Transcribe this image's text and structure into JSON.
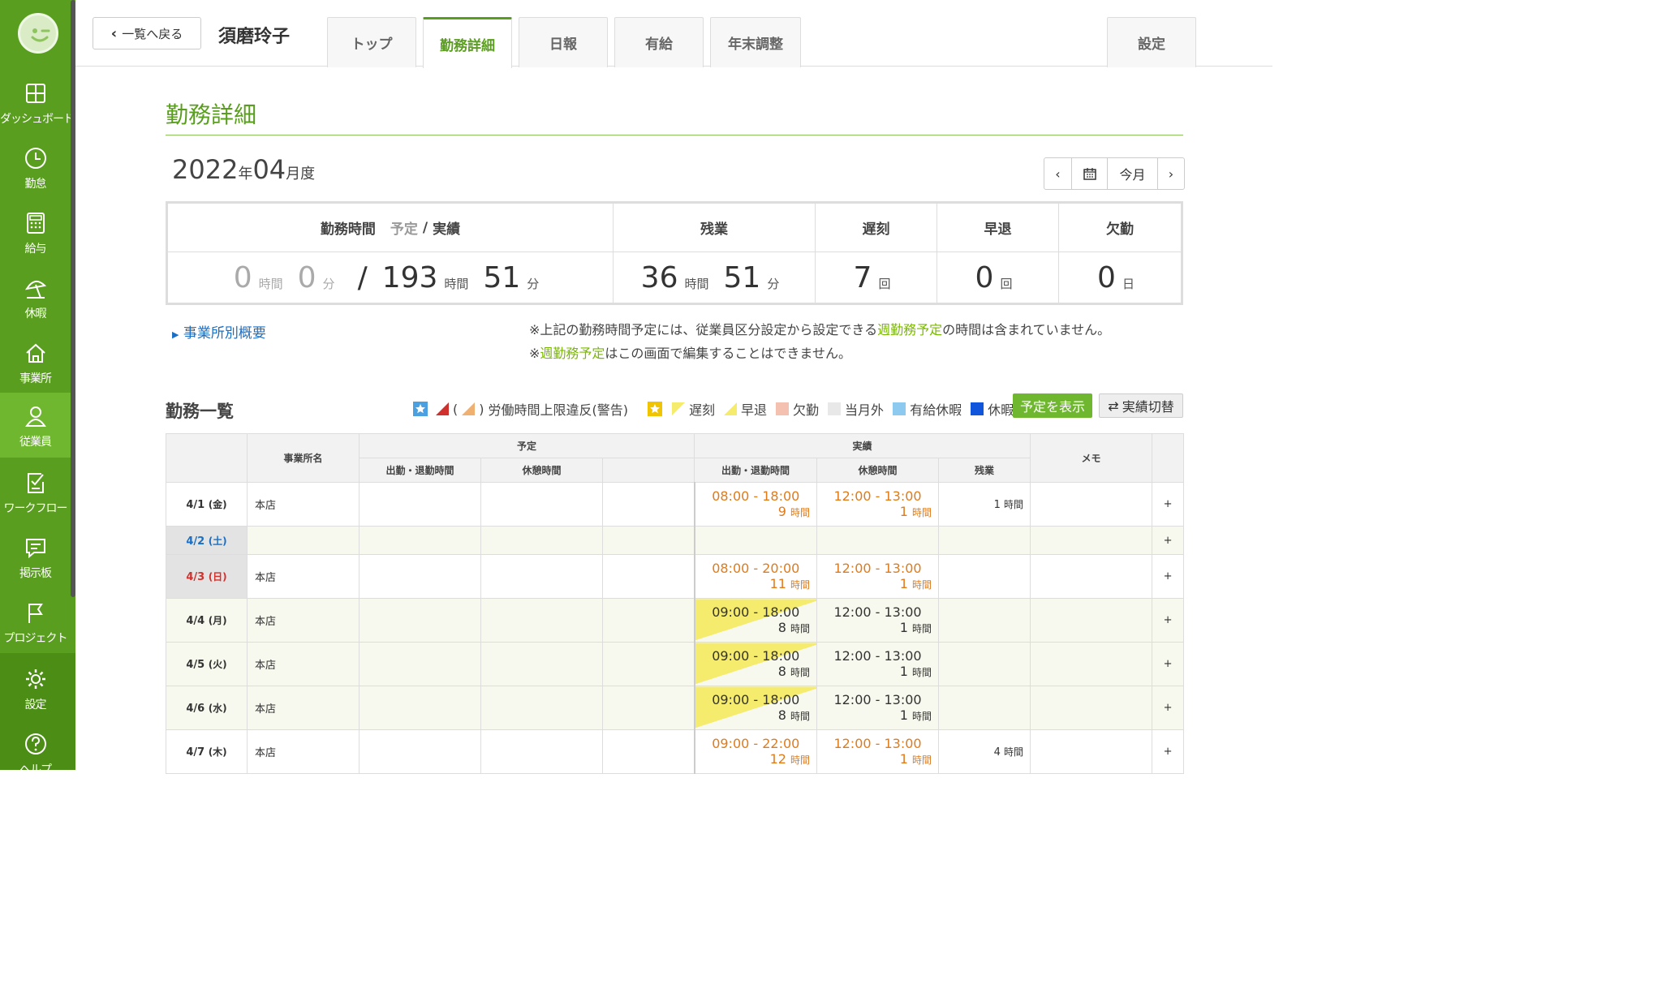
{
  "sidebar": {
    "items": [
      {
        "label": "ダッシュボード",
        "icon": "dashboard-icon"
      },
      {
        "label": "勤怠",
        "icon": "clock-icon"
      },
      {
        "label": "給与",
        "icon": "calculator-icon"
      },
      {
        "label": "休暇",
        "icon": "beach-umbrella-icon"
      },
      {
        "label": "事業所",
        "icon": "home-icon"
      },
      {
        "label": "従業員",
        "icon": "person-icon"
      },
      {
        "label": "ワークフロー",
        "icon": "checklist-icon"
      },
      {
        "label": "掲示板",
        "icon": "message-icon"
      },
      {
        "label": "プロジェクト",
        "icon": "flag-icon"
      },
      {
        "label": "設定",
        "icon": "gear-icon"
      },
      {
        "label": "ヘルプ",
        "icon": "help-icon"
      }
    ],
    "active_index": 5
  },
  "header": {
    "back_label": "一覧へ戻る",
    "employee_name": "須磨玲子",
    "tabs": [
      "トップ",
      "勤務詳細",
      "日報",
      "有給",
      "年末調整"
    ],
    "active_tab": "勤務詳細",
    "settings_tab": "設定"
  },
  "page": {
    "title": "勤務詳細",
    "year": "2022",
    "year_suffix": "年",
    "month": "04",
    "month_suffix": "月度",
    "today_label": "今月",
    "prev": "‹",
    "next": "›"
  },
  "summary": {
    "work_label": "勤務時間",
    "plan_label": "予定",
    "slash": "/",
    "actual_label": "実績",
    "plan_hours": "0",
    "plan_minutes": "0",
    "actual_hours": "193",
    "actual_minutes": "51",
    "hour_unit": "時間",
    "minute_unit": "分",
    "overtime_label": "残業",
    "overtime_hours": "36",
    "overtime_minutes": "51",
    "late_label": "遅刻",
    "late_count": "7",
    "early_label": "早退",
    "early_count": "0",
    "count_unit": "回",
    "absent_label": "欠勤",
    "absent_days": "0",
    "day_unit": "日"
  },
  "office_link": "事業所別概要",
  "notes": {
    "line1_a": "※上記の勤務時間予定には、従業員区分設定から設定できる",
    "line1_link": "週勤務予定",
    "line1_b": "の時間は含まれていません。",
    "line2_a": "※",
    "line2_link": "週勤務予定",
    "line2_b": "はこの画面で編集することはできません。"
  },
  "list": {
    "title": "勤務一覧",
    "legend": {
      "paren_open": "(",
      "paren_close": ")",
      "labor_violation": "労働時間上限違反(警告)",
      "late": "遅刻",
      "early": "早退",
      "absent": "欠勤",
      "outside": "当月外",
      "paid": "有給休暇",
      "holiday": "休暇"
    },
    "colors": {
      "late": "#f5ec6e",
      "absent": "#f4c0b0",
      "outside": "#e8e8e8",
      "paid": "#8ec9f0",
      "holiday": "#1155dd"
    },
    "show_plan_button": "予定を表示",
    "switch_button": "実績切替"
  },
  "table": {
    "headers": {
      "office": "事業所名",
      "plan": "予定",
      "actual": "実績",
      "memo": "メモ",
      "in_out": "出勤・退勤時間",
      "break": "休憩時間",
      "overtime": "残業"
    },
    "hour_unit": "時間",
    "plus": "+",
    "rows": [
      {
        "date": "4/1",
        "dow": "(金)",
        "office": "本店",
        "in_out": "08:00 - 18:00",
        "work_h": "9",
        "break": "12:00 - 13:00",
        "break_h": "1",
        "overtime": "1"
      },
      {
        "date": "4/2",
        "dow": "(土)",
        "office": "",
        "in_out": "",
        "work_h": "",
        "break": "",
        "break_h": "",
        "overtime": ""
      },
      {
        "date": "4/3",
        "dow": "(日)",
        "office": "本店",
        "in_out": "08:00 - 20:00",
        "work_h": "11",
        "break": "12:00 - 13:00",
        "break_h": "1",
        "overtime": ""
      },
      {
        "date": "4/4",
        "dow": "(月)",
        "office": "本店",
        "in_out": "09:00 - 18:00",
        "work_h": "8",
        "break": "12:00 - 13:00",
        "break_h": "1",
        "overtime": ""
      },
      {
        "date": "4/5",
        "dow": "(火)",
        "office": "本店",
        "in_out": "09:00 - 18:00",
        "work_h": "8",
        "break": "12:00 - 13:00",
        "break_h": "1",
        "overtime": ""
      },
      {
        "date": "4/6",
        "dow": "(水)",
        "office": "本店",
        "in_out": "09:00 - 18:00",
        "work_h": "8",
        "break": "12:00 - 13:00",
        "break_h": "1",
        "overtime": ""
      },
      {
        "date": "4/7",
        "dow": "(木)",
        "office": "本店",
        "in_out": "09:00 - 22:00",
        "work_h": "12",
        "break": "12:00 - 13:00",
        "break_h": "1",
        "overtime": "4"
      }
    ]
  }
}
